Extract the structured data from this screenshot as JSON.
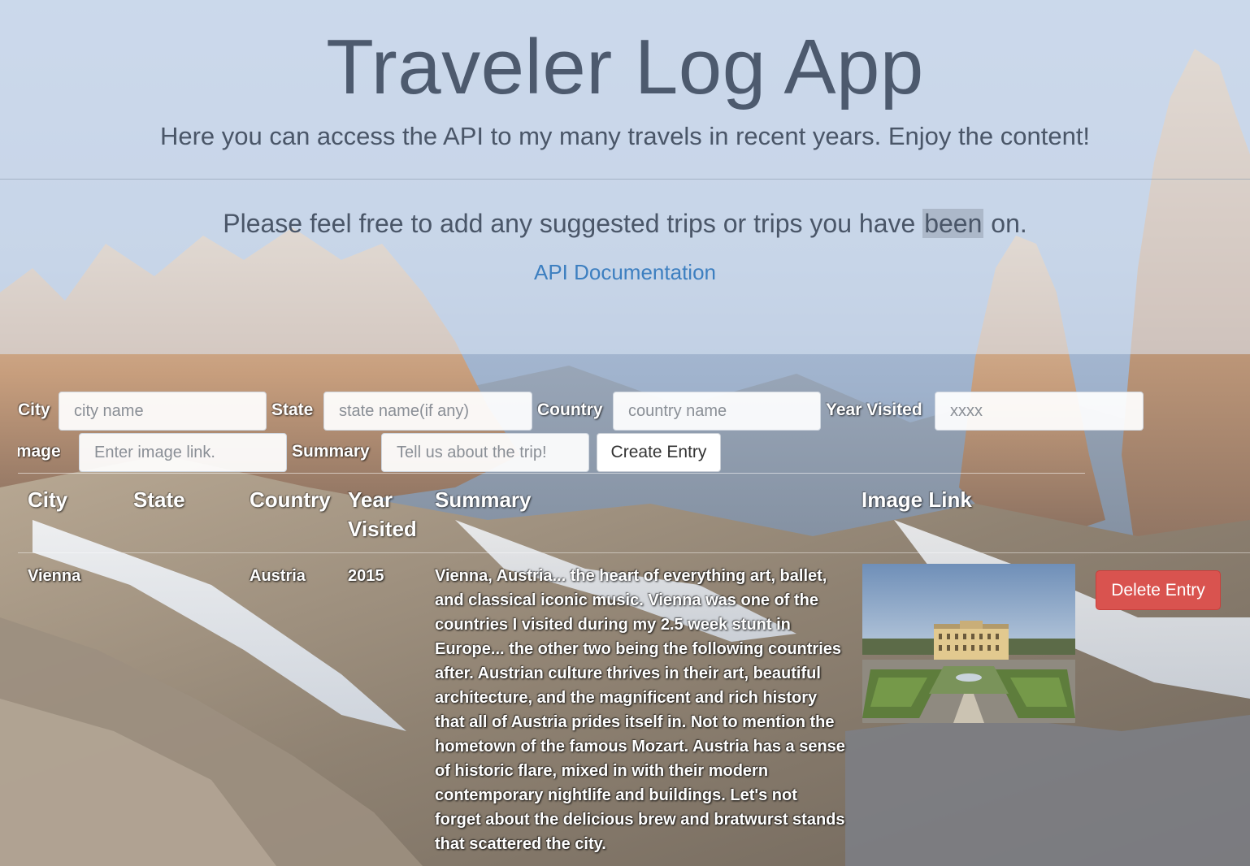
{
  "header": {
    "title": "Traveler Log App",
    "subtitle": "Here you can access the API to my many travels in recent years. Enjoy the content!",
    "invite_before": "Please feel free to add any suggested trips or trips you have ",
    "invite_highlight": "been",
    "invite_after": " on.",
    "api_link_label": "API Documentation"
  },
  "form": {
    "city_label": "City",
    "city_placeholder": "city name",
    "state_label": "State",
    "state_placeholder": "state name(if any)",
    "country_label": "Country",
    "country_placeholder": "country name",
    "year_label": "Year Visited",
    "year_placeholder": "xxxx",
    "image_label": "Image",
    "image_placeholder": "Enter image link.",
    "summary_label": "Summary",
    "summary_placeholder": "Tell us about the trip!",
    "create_button": "Create Entry"
  },
  "table": {
    "headers": {
      "city": "City",
      "state": "State",
      "country": "Country",
      "year": "Year Visited",
      "summary": "Summary",
      "image": "Image Link"
    },
    "rows": [
      {
        "city": "Vienna",
        "state": "",
        "country": "Austria",
        "year": "2015",
        "summary": "Vienna, Austria... the heart of everything art, ballet, and classical iconic music. Vienna was one of the countries I visited during my 2.5 week stunt in Europe... the other two being the following countries after. Austrian culture thrives in their art, beautiful architecture, and the magnificent and rich history that all of Austria prides itself in. Not to mention the hometown of the famous Mozart. Austria has a sense of historic flare, mixed in with their modern contemporary nightlife and buildings. Let's not forget about the delicious brew and bratwurst stands that scattered the city.",
        "image_alt": "palace-garden-photo",
        "delete_button": "Delete Entry"
      }
    ]
  },
  "colors": {
    "title_text": "#4d5a6e",
    "link": "#3d7fc0",
    "delete_button": "#d9534f"
  }
}
